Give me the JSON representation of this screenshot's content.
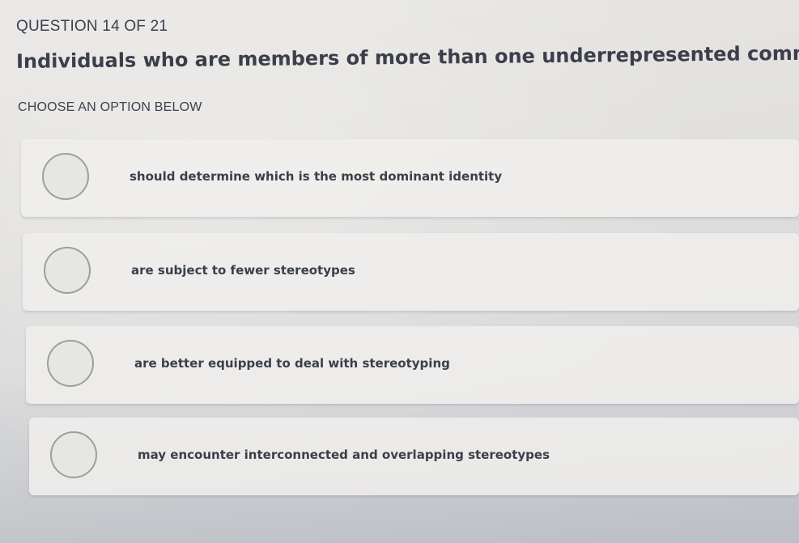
{
  "quiz": {
    "counter": "QUESTION 14 OF 21",
    "question": "Individuals who are members of more than one underrepresented community:",
    "instruction": "CHOOSE AN OPTION BELOW",
    "options": [
      {
        "label": "should determine which is the most dominant identity",
        "selected": false
      },
      {
        "label": "are subject to fewer stereotypes",
        "selected": false
      },
      {
        "label": "are better equipped to deal with stereotyping",
        "selected": false
      },
      {
        "label": "may encounter interconnected and overlapping stereotypes",
        "selected": false
      }
    ]
  }
}
